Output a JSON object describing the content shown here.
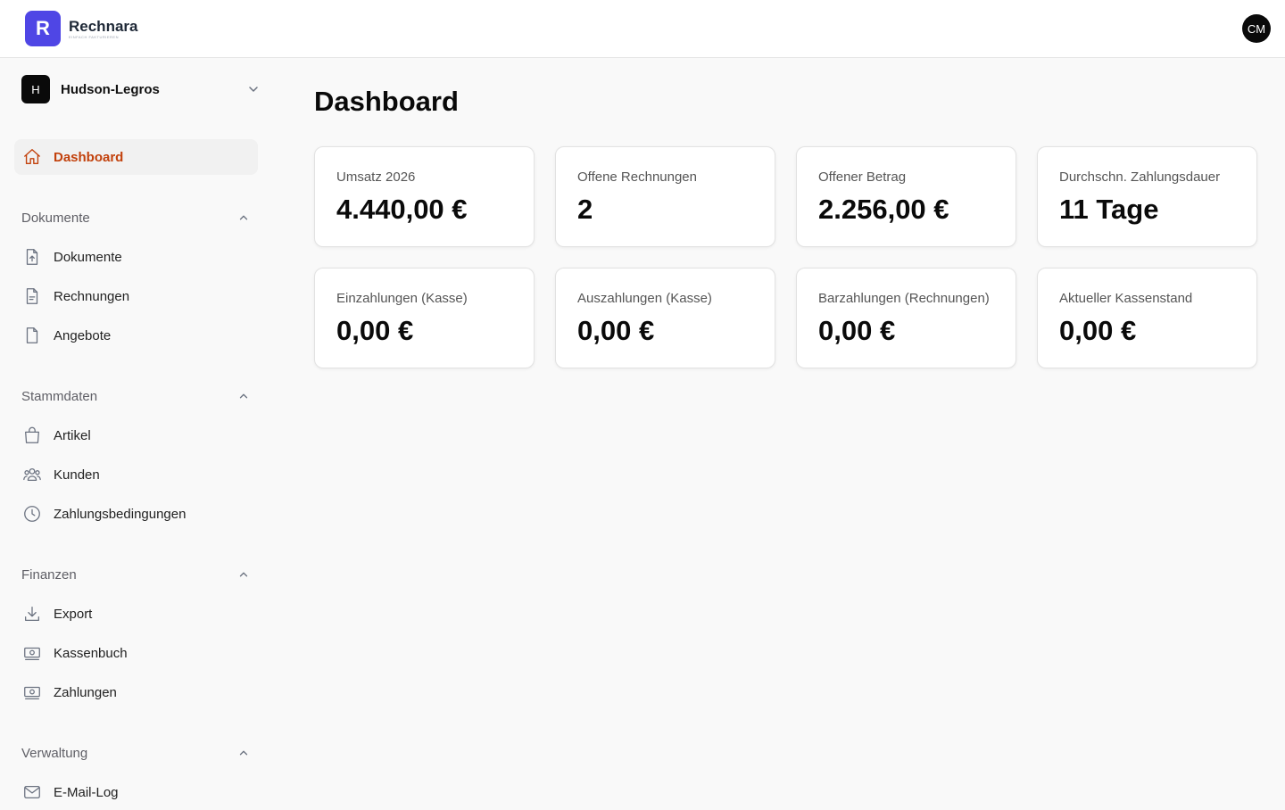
{
  "app": {
    "name": "Rechnara",
    "tagline": "EINFACH FAKTURIEREN",
    "logo_letter": "R",
    "brand_color": "#4f46e5",
    "accent_color": "#c2410c"
  },
  "user": {
    "initials": "CM"
  },
  "organization": {
    "badge": "H",
    "name": "Hudson-Legros"
  },
  "sidebar": {
    "dashboard": {
      "label": "Dashboard",
      "icon": "home-icon"
    },
    "sections": [
      {
        "title": "Dokumente",
        "items": [
          {
            "label": "Dokumente",
            "icon": "file-upload-icon"
          },
          {
            "label": "Rechnungen",
            "icon": "file-text-icon"
          },
          {
            "label": "Angebote",
            "icon": "file-icon"
          }
        ]
      },
      {
        "title": "Stammdaten",
        "items": [
          {
            "label": "Artikel",
            "icon": "shopping-bag-icon"
          },
          {
            "label": "Kunden",
            "icon": "users-icon"
          },
          {
            "label": "Zahlungsbedingungen",
            "icon": "clock-icon"
          }
        ]
      },
      {
        "title": "Finanzen",
        "items": [
          {
            "label": "Export",
            "icon": "download-icon"
          },
          {
            "label": "Kassenbuch",
            "icon": "banknote-icon"
          },
          {
            "label": "Zahlungen",
            "icon": "banknote-icon"
          }
        ]
      },
      {
        "title": "Verwaltung",
        "items": [
          {
            "label": "E-Mail-Log",
            "icon": "mail-icon"
          }
        ]
      }
    ]
  },
  "main": {
    "title": "Dashboard",
    "cards": [
      {
        "label": "Umsatz 2026",
        "value": "4.440,00 €"
      },
      {
        "label": "Offene Rechnungen",
        "value": "2"
      },
      {
        "label": "Offener Betrag",
        "value": "2.256,00 €"
      },
      {
        "label": "Durchschn. Zahlungsdauer",
        "value": "11 Tage"
      },
      {
        "label": "Einzahlungen (Kasse)",
        "value": "0,00 €"
      },
      {
        "label": "Auszahlungen (Kasse)",
        "value": "0,00 €"
      },
      {
        "label": "Barzahlungen (Rechnungen)",
        "value": "0,00 €"
      },
      {
        "label": "Aktueller Kassenstand",
        "value": "0,00 €"
      }
    ]
  }
}
